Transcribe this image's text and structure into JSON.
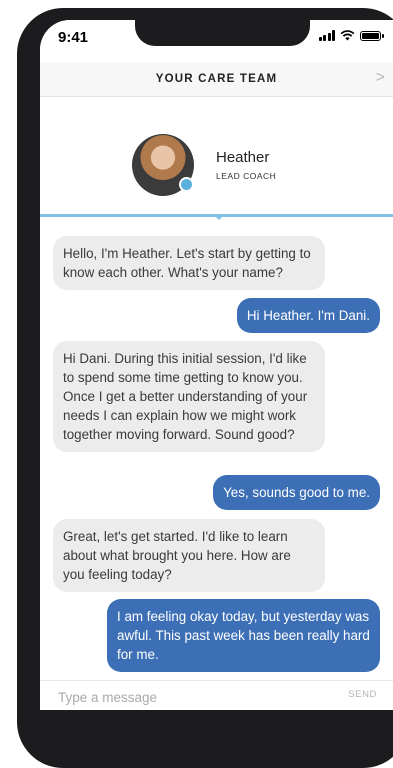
{
  "status_bar": {
    "time": "9:41"
  },
  "header": {
    "title": "YOUR CARE TEAM",
    "chevron": ">"
  },
  "coach": {
    "name": "Heather",
    "role": "LEAD COACH"
  },
  "messages": [
    {
      "sender": "coach",
      "text": "Hello, I'm Heather. Let's start by getting to know each other. What's your name?"
    },
    {
      "sender": "user",
      "text": "Hi Heather. I'm Dani."
    },
    {
      "sender": "coach",
      "text": "Hi Dani. During this initial session, I'd like to spend some time getting to know you. Once I get a better understanding of your needs I can explain how we might work together moving forward. Sound good?"
    },
    {
      "sender": "user",
      "text": "Yes, sounds good to me."
    },
    {
      "sender": "coach",
      "text": "Great, let's get started. I'd like to learn about what brought you here. How are you feeling today?"
    },
    {
      "sender": "user",
      "text": "I am feeling okay today, but yesterday was awful. This past week has been really hard for me."
    }
  ],
  "composer": {
    "placeholder": "Type a message",
    "send_label": "SEND",
    "value": ""
  }
}
